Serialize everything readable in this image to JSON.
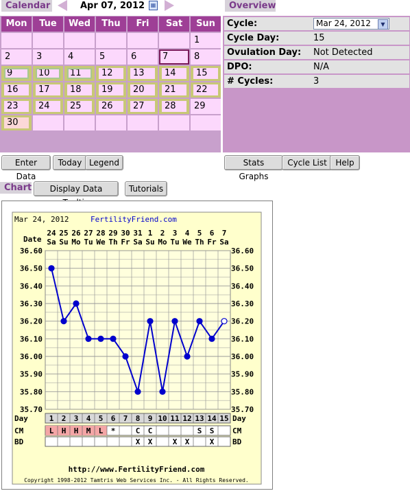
{
  "calendar": {
    "tab_label": "Calendar",
    "date_label": "Apr 07, 2012",
    "weekdays": [
      "Mon",
      "Tue",
      "Wed",
      "Thu",
      "Fri",
      "Sat",
      "Sun"
    ],
    "rows": [
      [
        "",
        "",
        "",
        "",
        "",
        "",
        "1"
      ],
      [
        "2",
        "3",
        "4",
        "5",
        "6",
        "7",
        "8"
      ],
      [
        "9",
        "10",
        "11",
        "12",
        "13",
        "14",
        "15"
      ],
      [
        "16",
        "17",
        "18",
        "19",
        "20",
        "21",
        "22"
      ],
      [
        "23",
        "24",
        "25",
        "26",
        "27",
        "28",
        "29"
      ],
      [
        "30",
        "",
        "",
        "",
        "",
        "",
        ""
      ]
    ],
    "buttons": {
      "enter_data": "Enter Data",
      "today": "Today",
      "legend": "Legend"
    }
  },
  "overview": {
    "tab_label": "Overview",
    "rows": [
      {
        "label": "Cycle:",
        "value": "Mar 24, 2012"
      },
      {
        "label": "Cycle Day:",
        "value": "15"
      },
      {
        "label": "Ovulation Day:",
        "value": "Not Detected"
      },
      {
        "label": "DPO:",
        "value": "N/A"
      },
      {
        "label": "# Cycles:",
        "value": "3"
      }
    ],
    "buttons": {
      "stats_graphs": "Stats Graphs",
      "cycle_list": "Cycle List",
      "help": "Help"
    }
  },
  "chart_section": {
    "tab_label": "Chart",
    "buttons": {
      "tooltip": "Display Data Tooltip",
      "tutorials": "Tutorials"
    }
  },
  "chart_data": {
    "type": "line",
    "header_date": "Mar 24, 2012",
    "site": "FertilityFriend.com",
    "date_row_label": "Date",
    "day_row_label": "Day",
    "cm_label": "CM",
    "bd_label": "BD",
    "dates": [
      "24",
      "25",
      "26",
      "27",
      "28",
      "29",
      "30",
      "31",
      "1",
      "2",
      "3",
      "4",
      "5",
      "6",
      "7"
    ],
    "weekdays": [
      "Sa",
      "Su",
      "Mo",
      "Tu",
      "We",
      "Th",
      "Fr",
      "Sa",
      "Su",
      "Mo",
      "Tu",
      "We",
      "Th",
      "Fr",
      "Sa"
    ],
    "days": [
      "1",
      "2",
      "3",
      "4",
      "5",
      "6",
      "7",
      "8",
      "9",
      "10",
      "11",
      "12",
      "13",
      "14",
      "15"
    ],
    "temps": [
      36.5,
      36.2,
      36.3,
      36.1,
      36.1,
      36.1,
      36.0,
      35.8,
      36.2,
      35.8,
      36.2,
      36.0,
      36.2,
      36.1,
      36.2
    ],
    "ylim": [
      35.7,
      36.6
    ],
    "yticks": [
      "36.60",
      "36.50",
      "36.40",
      "36.30",
      "36.20",
      "36.10",
      "36.00",
      "35.90",
      "35.80",
      "35.70"
    ],
    "cm": [
      "L",
      "H",
      "H",
      "M",
      "L",
      "*",
      "",
      "C",
      "C",
      "",
      "",
      "",
      "S",
      "S",
      ""
    ],
    "bd": [
      "",
      "",
      "",
      "",
      "",
      "",
      "",
      "X",
      "X",
      "",
      "X",
      "X",
      "",
      "X",
      ""
    ],
    "footer_url": "http://www.FertilityFriend.com",
    "copyright": "Copyright 1998-2012 Tamtris Web Services Inc. - All Rights Reserved.",
    "colors": {
      "bg": "#ffffcc",
      "line": "#0000cc",
      "period": "#f4a6a6",
      "grid": "#999999"
    }
  }
}
